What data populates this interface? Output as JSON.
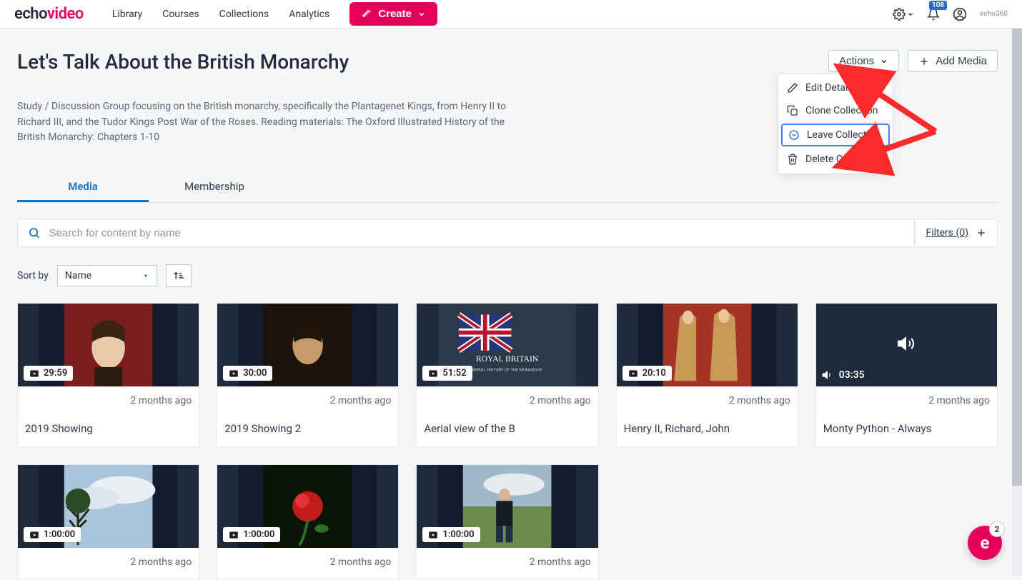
{
  "topbar": {
    "logo_a": "echo",
    "logo_b": "video",
    "brand_mark": "echo360",
    "nav": [
      "Library",
      "Courses",
      "Collections",
      "Analytics"
    ],
    "create_label": "Create",
    "notification_count": "108"
  },
  "page": {
    "title": "Let's Talk About the British Monarchy",
    "description": "Study / Discussion Group focusing on the British monarchy, specifically the Plantagenet Kings, from Henry II to Richard III, and the Tudor Kings Post War of the Roses. Reading materials: The Oxford Illustrated History of the British Monarchy: Chapters 1-10"
  },
  "actions": {
    "button_label": "Actions",
    "add_media_label": "Add Media",
    "menu": {
      "edit": "Edit Details",
      "clone": "Clone Collection",
      "leave": "Leave Collection",
      "delete": "Delete Collection"
    }
  },
  "tabs": {
    "media": "Media",
    "membership": "Membership"
  },
  "search": {
    "placeholder": "Search for content by name"
  },
  "filters": {
    "label": "Filters (0)"
  },
  "sort": {
    "label": "Sort by",
    "value": "Name"
  },
  "fab": {
    "count": "2"
  },
  "cards": [
    {
      "duration": "29:59",
      "time": "2 months ago",
      "title": "2019 Showing",
      "kind": "video"
    },
    {
      "duration": "30:00",
      "time": "2 months ago",
      "title": "2019 Showing 2",
      "kind": "video"
    },
    {
      "duration": "51:52",
      "time": "2 months ago",
      "title": "Aerial view of the B",
      "kind": "video"
    },
    {
      "duration": "20:10",
      "time": "2 months ago",
      "title": "Henry II, Richard, John",
      "kind": "video"
    },
    {
      "duration": "03:35",
      "time": "2 months ago",
      "title": "Monty Python - Always",
      "kind": "audio"
    },
    {
      "duration": "1:00:00",
      "time": "2 months ago",
      "title": "",
      "kind": "video"
    },
    {
      "duration": "1:00:00",
      "time": "2 months ago",
      "title": "",
      "kind": "video"
    },
    {
      "duration": "1:00:00",
      "time": "2 months ago",
      "title": "",
      "kind": "video"
    }
  ]
}
